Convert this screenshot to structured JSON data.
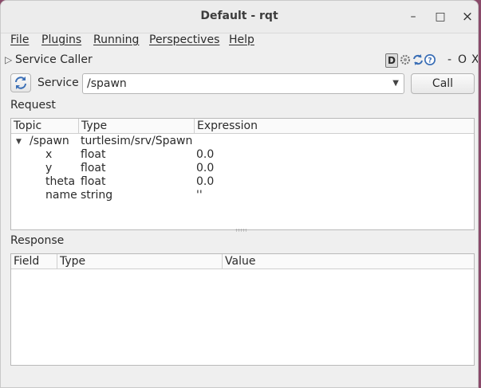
{
  "window": {
    "title": "Default - rqt"
  },
  "window_controls": {
    "minimize": "–",
    "maximize": "□",
    "close": "×"
  },
  "menubar": [
    {
      "label": "File"
    },
    {
      "label": "Plugins"
    },
    {
      "label": "Running"
    },
    {
      "label": "Perspectives"
    },
    {
      "label": "Help"
    }
  ],
  "dock": {
    "title": "Service Caller",
    "d_label": "D",
    "dash_label": "-",
    "o_label": "O",
    "x_label": "X"
  },
  "service": {
    "label": "Service",
    "selected": "/spawn",
    "call_label": "Call"
  },
  "request": {
    "label": "Request",
    "columns": [
      "Topic",
      "Type",
      "Expression"
    ],
    "root": {
      "topic": "/spawn",
      "type": "turtlesim/srv/Spawn",
      "expression": ""
    },
    "rows": [
      {
        "topic": "x",
        "type": "float",
        "expression": "0.0"
      },
      {
        "topic": "y",
        "type": "float",
        "expression": "0.0"
      },
      {
        "topic": "theta",
        "type": "float",
        "expression": "0.0"
      },
      {
        "topic": "name",
        "type": "string",
        "expression": "''"
      }
    ]
  },
  "response": {
    "label": "Response",
    "columns": [
      "Field",
      "Type",
      "Value"
    ]
  },
  "colors": {
    "window_bg": "#efefef",
    "desktop": "#8a4a6a"
  }
}
